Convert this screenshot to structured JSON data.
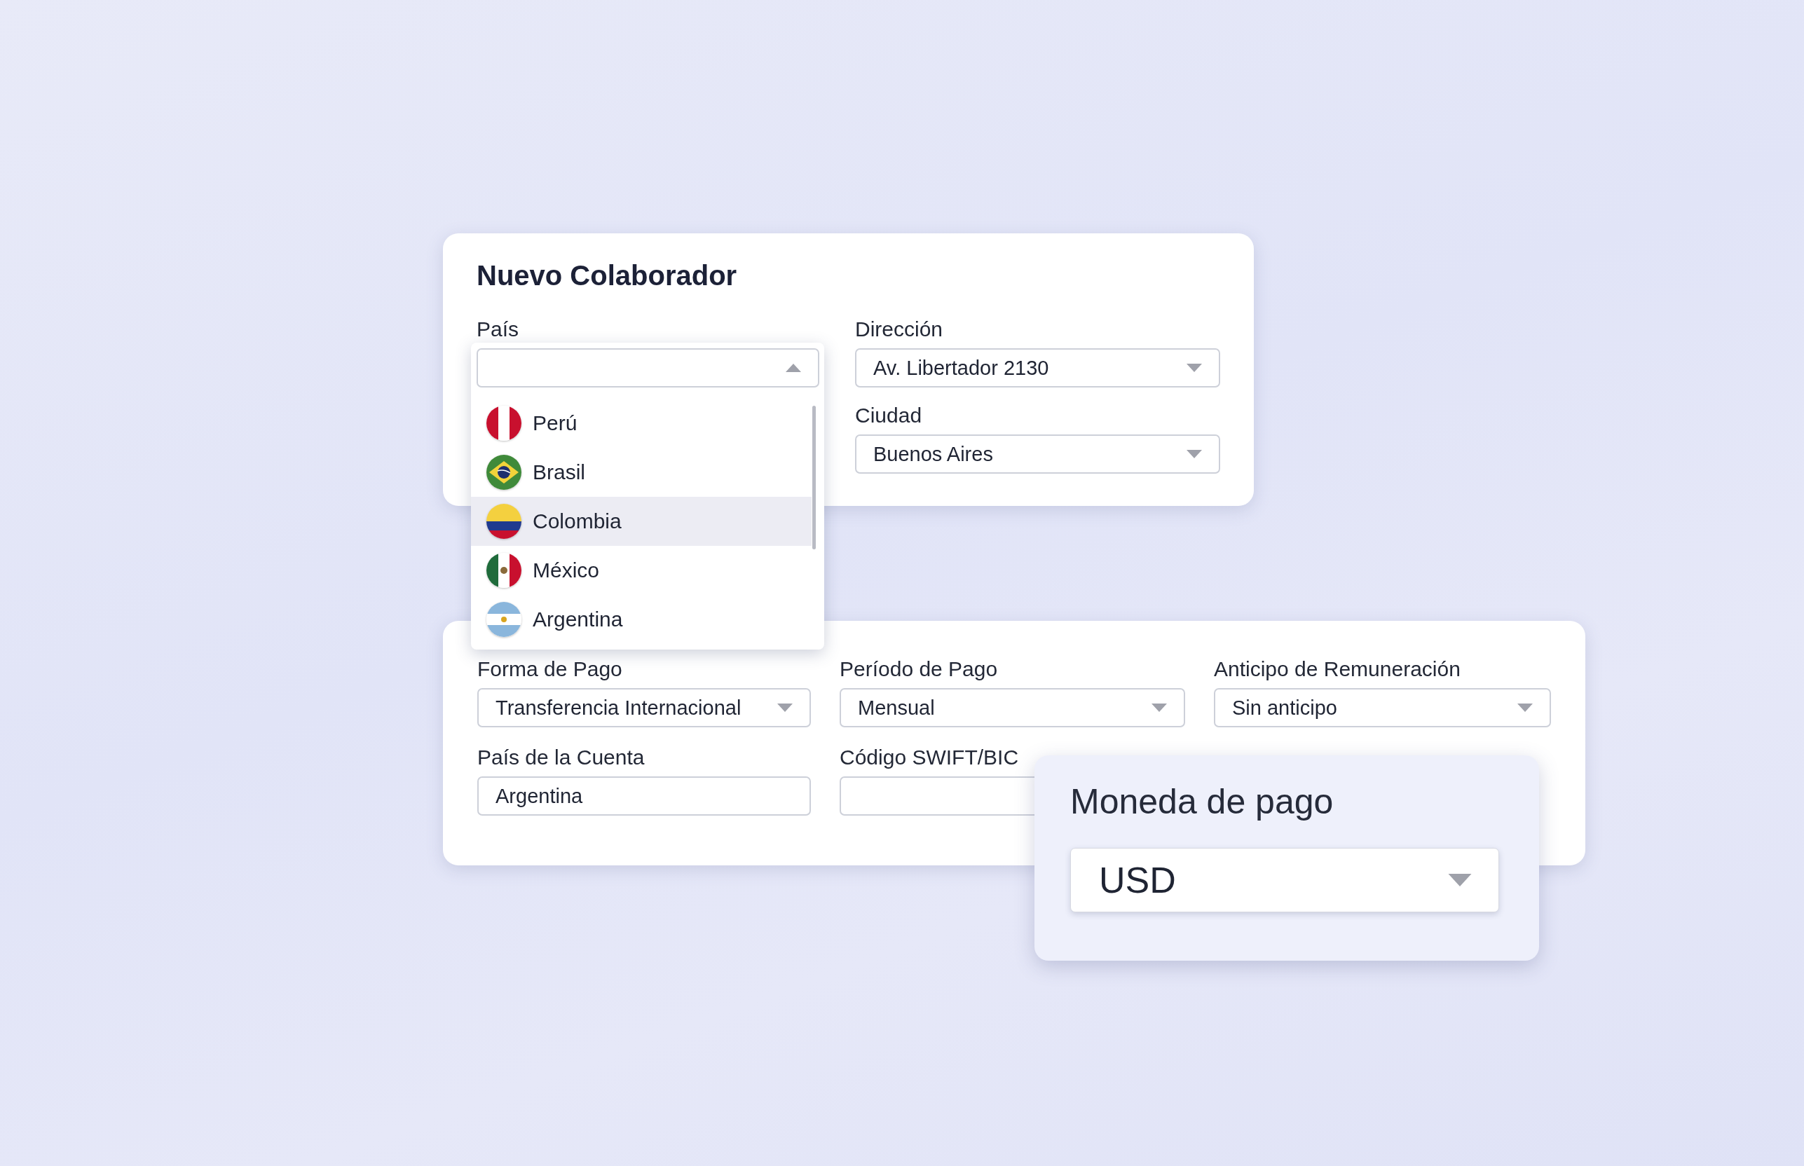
{
  "title": "Nuevo Colaborador",
  "country": {
    "label": "País",
    "expanded": true,
    "options": [
      {
        "name": "Perú",
        "kind": "pe",
        "selected": false
      },
      {
        "name": "Brasil",
        "kind": "br",
        "selected": false
      },
      {
        "name": "Colombia",
        "kind": "co",
        "selected": true
      },
      {
        "name": "México",
        "kind": "mx",
        "selected": false
      },
      {
        "name": "Argentina",
        "kind": "ar",
        "selected": false
      }
    ]
  },
  "address_fields": [
    {
      "label": "Dirección",
      "value": "Av. Libertador 2130",
      "kind": "select"
    },
    {
      "label": "Ciudad",
      "value": "Buenos Aires",
      "kind": "select"
    }
  ],
  "payment_fields": [
    {
      "label": "Forma de Pago",
      "value": "Transferencia Internacional",
      "kind": "select"
    },
    {
      "label": "Período de Pago",
      "value": "Mensual",
      "kind": "select"
    },
    {
      "label": "Anticipo de Remuneración",
      "value": "Sin anticipo",
      "kind": "select"
    },
    {
      "label": "País de la Cuenta",
      "value": "Argentina",
      "kind": "text"
    },
    {
      "label": "Código SWIFT/BIC",
      "kind": "text"
    }
  ],
  "currency": {
    "label": "Moneda de pago",
    "value": "USD",
    "kind": "select"
  }
}
